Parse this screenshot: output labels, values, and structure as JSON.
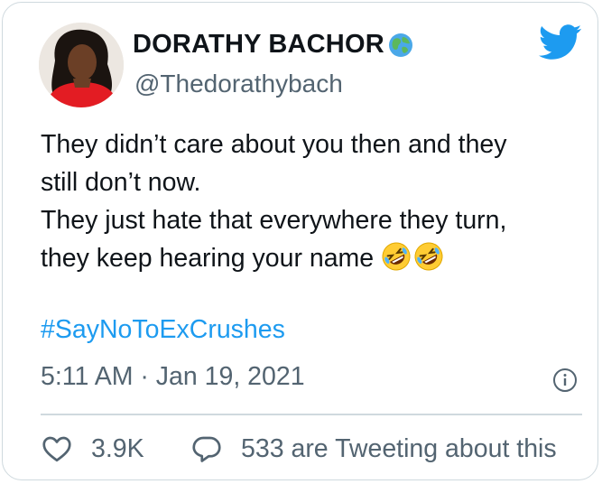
{
  "author": {
    "display_name": "DORATHY BACHOR",
    "handle": "@Thedorathybach",
    "avatar_icon": "profile-photo",
    "name_emoji": "earth-globe-emoji"
  },
  "tweet": {
    "lines": [
      "They didn’t care about you then and they",
      "still don’t now.",
      "They just hate that everywhere they turn,",
      "they keep hearing your name"
    ],
    "emoji": "rolling-on-floor-laughing-emoji",
    "hashtag": "#SayNoToExCrushes",
    "timestamp": "5:11 AM · Jan 19, 2021"
  },
  "actions": {
    "like_count": "3.9K",
    "conversation_text": "533 are Tweeting about this"
  },
  "icons": {
    "brand": "twitter-bird-icon",
    "info": "info-icon",
    "like": "heart-icon",
    "reply": "reply-bubble-icon"
  },
  "colors": {
    "brand_blue": "#1d9bf0",
    "text_primary": "#0f1419",
    "text_secondary": "#536471",
    "border": "#cfd9de"
  }
}
